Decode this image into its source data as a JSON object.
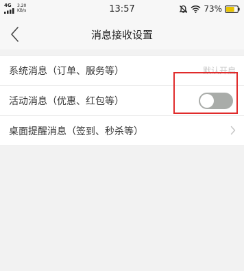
{
  "status_bar": {
    "network": "4G",
    "speed_value": "3.20",
    "speed_unit": "KB/s",
    "time": "13:57",
    "battery_percent": "73%",
    "icons": [
      "signal-icon",
      "mute-bell-icon",
      "wifi-icon",
      "battery-icon"
    ]
  },
  "nav": {
    "title": "消息接收设置",
    "back_icon": "chevron-left-icon"
  },
  "settings": [
    {
      "label": "系统消息（订单、服务等）",
      "value": "默认开启"
    },
    {
      "label": "活动消息（优惠、红包等）",
      "toggle_on": false
    },
    {
      "label": "桌面提醒消息（签到、秒杀等）",
      "icon": "chevron-right-icon"
    }
  ],
  "colors": {
    "background": "#f2f2f2",
    "highlight": "#e02b2b",
    "toggle_off": "#a9aca9",
    "battery_fill": "#e8c300"
  }
}
